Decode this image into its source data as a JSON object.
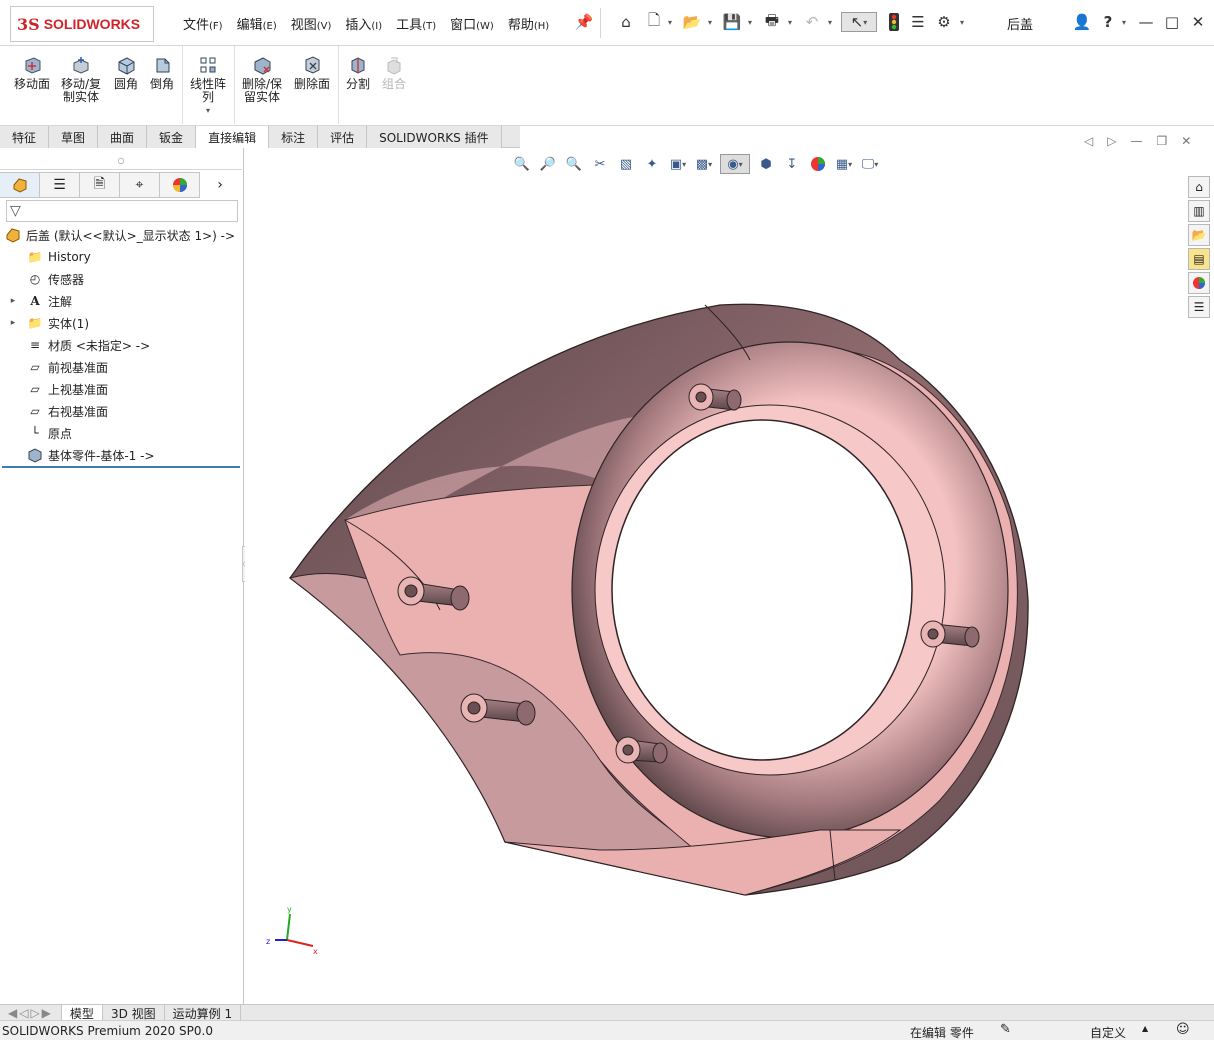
{
  "app": {
    "brand_prefix": "3S",
    "brand": "SOLIDWORKS",
    "doc_title": "后盖"
  },
  "menu": [
    {
      "label": "文件",
      "key": "(F)"
    },
    {
      "label": "编辑",
      "key": "(E)"
    },
    {
      "label": "视图",
      "key": "(V)"
    },
    {
      "label": "插入",
      "key": "(I)"
    },
    {
      "label": "工具",
      "key": "(T)"
    },
    {
      "label": "窗口",
      "key": "(W)"
    },
    {
      "label": "帮助",
      "key": "(H)"
    }
  ],
  "ribbon": {
    "move_face": "移动面",
    "move_copy_body": "移动/复制实体",
    "fillet": "圆角",
    "chamfer": "倒角",
    "linear_pattern": "线性阵列",
    "delete_keep_body": "删除/保留实体",
    "delete_face": "删除面",
    "split": "分割",
    "combine": "组合"
  },
  "tabs": [
    "特征",
    "草图",
    "曲面",
    "钣金",
    "直接编辑",
    "标注",
    "评估",
    "SOLIDWORKS 插件"
  ],
  "active_tab": "直接编辑",
  "tree": {
    "root": "后盖 (默认<<默认>_显示状态 1>) ->",
    "items": [
      {
        "label": "History"
      },
      {
        "label": "传感器"
      },
      {
        "label": "注解"
      },
      {
        "label": "实体(1)"
      },
      {
        "label": "材质 <未指定> ->"
      },
      {
        "label": "前视基准面"
      },
      {
        "label": "上视基准面"
      },
      {
        "label": "右视基准面"
      },
      {
        "label": "原点"
      },
      {
        "label": "基体零件-基体-1 ->"
      }
    ]
  },
  "bottom_tabs": [
    "模型",
    "3D 视图",
    "运动算例 1"
  ],
  "status": {
    "version": "SOLIDWORKS Premium 2020 SP0.0",
    "editing": "在编辑 零件",
    "custom": "自定义"
  },
  "triad": {
    "x": "x",
    "y": "y",
    "z": "z"
  },
  "colors": {
    "accent_red": "#d2232a",
    "part_dark": "#5e4a4e",
    "part_light": "#f1b6b6",
    "tree_selection": "#3d7ab0"
  }
}
